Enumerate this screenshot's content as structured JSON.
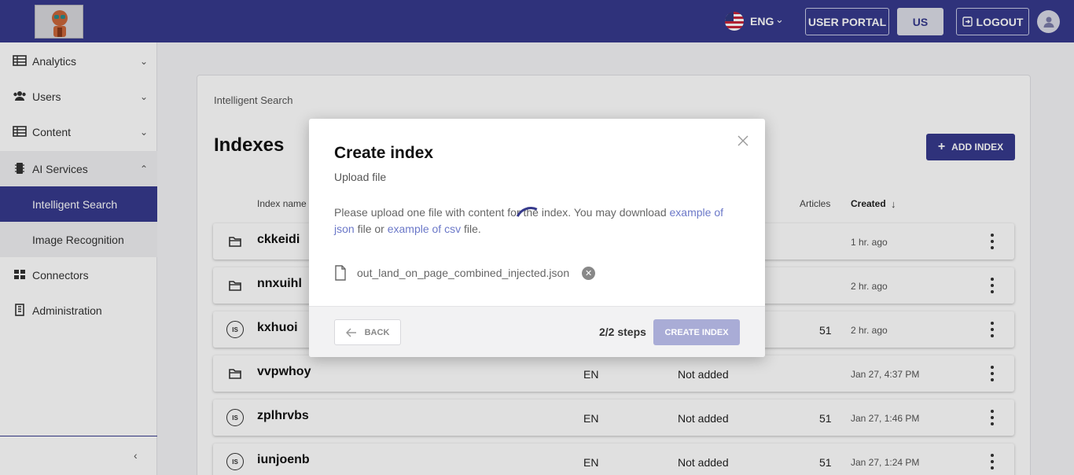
{
  "header": {
    "language": "ENG",
    "user_portal_label": "USER PORTAL",
    "region_label": "US",
    "logout_label": "LOGOUT"
  },
  "sidebar": {
    "items": [
      {
        "label": "Analytics",
        "icon": "table-icon"
      },
      {
        "label": "Users",
        "icon": "users-icon"
      },
      {
        "label": "Content",
        "icon": "table-icon"
      },
      {
        "label": "AI Services",
        "icon": "chip-icon"
      },
      {
        "label": "Intelligent Search",
        "icon": "",
        "active": true
      },
      {
        "label": "Image Recognition",
        "icon": ""
      },
      {
        "label": "Connectors",
        "icon": "grid-icon"
      },
      {
        "label": "Administration",
        "icon": "building-icon"
      }
    ],
    "collapse_icon": "chevron-left-icon"
  },
  "main": {
    "breadcrumb": "Intelligent Search",
    "title": "Indexes",
    "add_button_label": "ADD INDEX",
    "columns": {
      "name": "Index name",
      "articles": "Articles",
      "created": "Created"
    },
    "rows": [
      {
        "name": "ckkeidi",
        "type": "folder",
        "language": "",
        "status": "",
        "articles": "",
        "created": "1 hr. ago"
      },
      {
        "name": "nnxuihl",
        "type": "folder",
        "language": "",
        "status": "",
        "articles": "",
        "created": "2 hr. ago"
      },
      {
        "name": "kxhuoi",
        "type": "IS",
        "language": "",
        "status": "",
        "articles": "51",
        "created": "2 hr. ago"
      },
      {
        "name": "vvpwhoy",
        "type": "folder",
        "language": "EN",
        "status": "Not added",
        "articles": "",
        "created": "Jan 27, 4:37 PM"
      },
      {
        "name": "zplhrvbs",
        "type": "IS",
        "language": "EN",
        "status": "Not added",
        "articles": "51",
        "created": "Jan 27, 1:46 PM"
      },
      {
        "name": "iunjoenb",
        "type": "IS",
        "language": "EN",
        "status": "Not added",
        "articles": "51",
        "created": "Jan 27, 1:24 PM"
      }
    ]
  },
  "modal": {
    "title": "Create index",
    "subtitle": "Upload file",
    "text_prefix": "Please upload one file with content for the index. You may download",
    "json_link": "example of json",
    "text_mid": "file or",
    "csv_link": "example of csv",
    "text_suffix": "file.",
    "file_name": "out_land_on_page_combined_injected.json",
    "back_label": "BACK",
    "steps": "2/2 steps",
    "create_label": "CREATE INDEX"
  },
  "colors": {
    "brand": "#363a8c",
    "link": "#6b78c8",
    "disabled_button": "#a9acd6"
  }
}
